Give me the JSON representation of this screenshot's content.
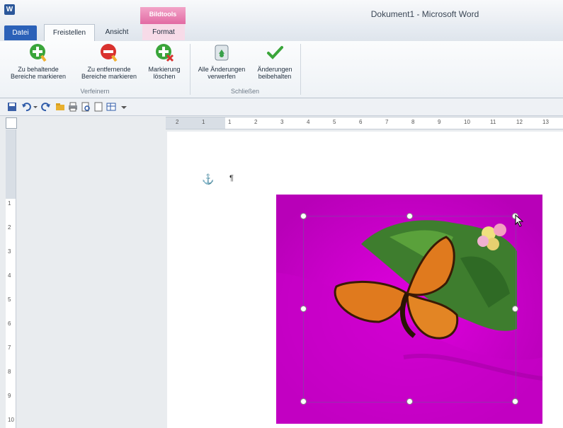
{
  "titlebar": {
    "app_icon_letter": "W",
    "window_title": "Dokument1  -  Microsoft Word",
    "context_group": "Bildtools"
  },
  "tabs": [
    {
      "label": "Datei"
    },
    {
      "label": "Freistellen"
    },
    {
      "label": "Ansicht"
    },
    {
      "label": "Format"
    }
  ],
  "ribbon": {
    "refine_group": {
      "label": "Verfeinern",
      "keep": {
        "line1": "Zu behaltende",
        "line2": "Bereiche markieren"
      },
      "remove": {
        "line1": "Zu entfernende",
        "line2": "Bereiche markieren"
      },
      "delete_mark": {
        "line1": "Markierung",
        "line2": "löschen"
      }
    },
    "close_group": {
      "label": "Schließen",
      "discard": {
        "line1": "Alle Änderungen",
        "line2": "verwerfen"
      },
      "keep_changes": {
        "line1": "Änderungen",
        "line2": "beibehalten"
      }
    }
  },
  "quick_access": {
    "icons": [
      "save-icon",
      "undo-icon",
      "undo-dropdown-icon",
      "redo-icon",
      "open-icon",
      "print-icon",
      "print-preview-icon",
      "new-icon",
      "table-icon",
      "customize-dropdown-icon"
    ]
  },
  "ruler": {
    "horizontal_ticks": [
      "2",
      "1",
      "1",
      "2",
      "3",
      "4",
      "5",
      "6",
      "7",
      "8",
      "9",
      "10",
      "11",
      "12",
      "13"
    ],
    "vertical_ticks": [
      "1",
      "2",
      "3",
      "4",
      "5",
      "6",
      "7",
      "8",
      "9",
      "10"
    ]
  },
  "document": {
    "anchor_glyph": "⚓",
    "pilcrow_glyph": "¶"
  },
  "colors": {
    "accent_blue": "#2b61b8",
    "context_pink": "#e26aa3",
    "removal_magenta": "#d400d0",
    "green_ok": "#3aa53a"
  }
}
